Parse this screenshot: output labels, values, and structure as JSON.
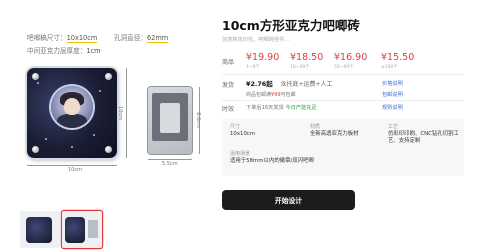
{
  "specs": {
    "size_label": "吧唧稿尺寸：",
    "size_value": "10x10cm",
    "hole_label": "孔洞直径：",
    "hole_value": "62mm",
    "thickness_label": "中间亚克力层厚度：",
    "thickness_value": "1cm"
  },
  "dimensions": {
    "badge_width": "62mm",
    "acrylic_width": "10cm",
    "acrylic_height": "10cm",
    "card_width": "5.5cm",
    "card_height": "8.6cm"
  },
  "product": {
    "title": "10cm方形亚克力吧唧砖",
    "subtitle": "创意棉花印花，吧唧砖挂件..."
  },
  "pricing": {
    "label": "商品",
    "tiers": [
      {
        "price": "¥19.90",
        "qty": "1~9个"
      },
      {
        "price": "¥18.50",
        "qty": "10~49个"
      },
      {
        "price": "¥16.90",
        "qty": "50~99个"
      },
      {
        "price": "¥15.50",
        "qty": "≥100个"
      }
    ]
  },
  "shipping": {
    "label": "发货",
    "amount": "¥2.76起",
    "note": "含托底+运费+人工",
    "link_price": "价格说明",
    "link_pack": "包邮说明",
    "promo_prefix": "商品包邮满",
    "promo_amount": "¥99",
    "promo_suffix": "可包邮"
  },
  "timing": {
    "label": "时效",
    "text": "下单后16天发货",
    "highlight": "今日产能充足",
    "link": "规则说明"
  },
  "spec_panel": {
    "size_header": "尺寸",
    "size_value": "10x10cm",
    "material_header": "材质",
    "material_value": "全新高透亚克力板材",
    "craft_header": "工艺",
    "craft_value": "仿彩印印刷、CNC钻孔切割工艺、支持定制",
    "scene_header": "适用场景",
    "scene_value": "适用于58mm以内的徽章/双闪吧唧"
  },
  "cta": {
    "label": "开始设计"
  }
}
